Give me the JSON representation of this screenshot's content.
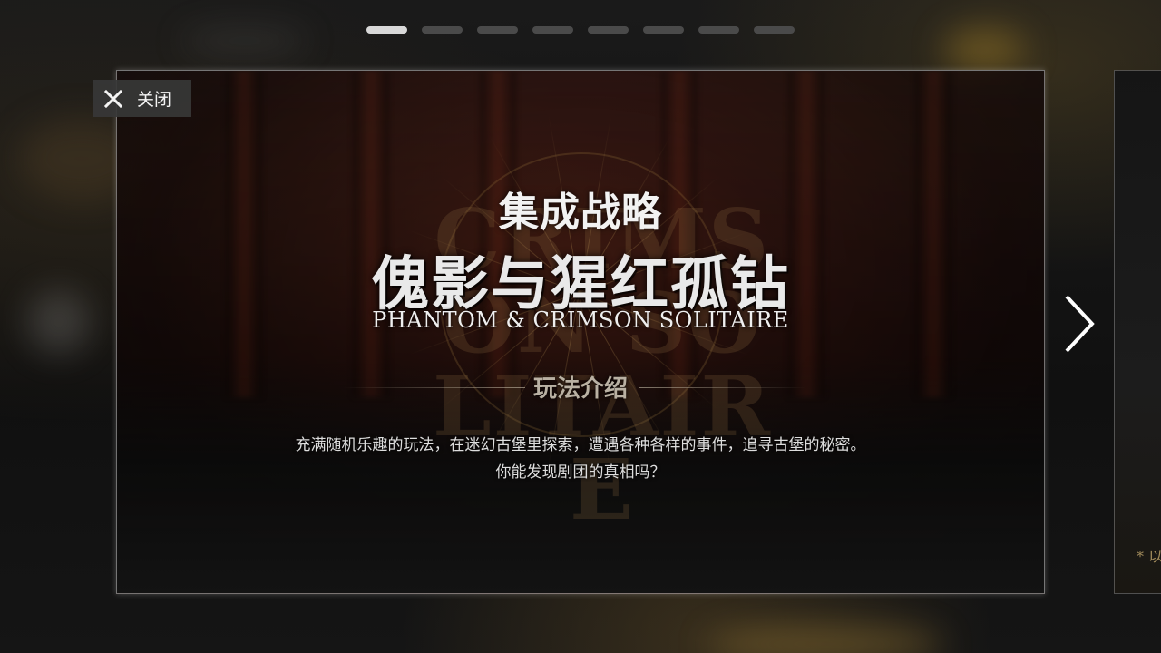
{
  "pager": {
    "count": 8,
    "active_index": 0
  },
  "close_button": {
    "label": "关闭",
    "icon": "close-icon"
  },
  "next_button": {
    "icon": "chevron-right-icon"
  },
  "banner": {
    "title_small": "集成战略",
    "title_large": "傀影与猩红孤钻",
    "title_en": "PHANTOM & CRIMSON SOLITAIRE",
    "background_letters": "CRIMSON SOLITAIRE",
    "section_label": "玩法介绍",
    "description_line1": "充满随机乐趣的玩法，在迷幻古堡里探索，遭遇各种各样的事件，追寻古堡的秘密。",
    "description_line2": "你能发现剧团的真相吗？"
  },
  "next_card": {
    "peek_text": "* 以"
  },
  "colors": {
    "accent_gold": "#b8965a",
    "crimson": "#6e1c12",
    "pager_active": "#d8d8d8",
    "pager_inactive": "#4a4a4a"
  }
}
